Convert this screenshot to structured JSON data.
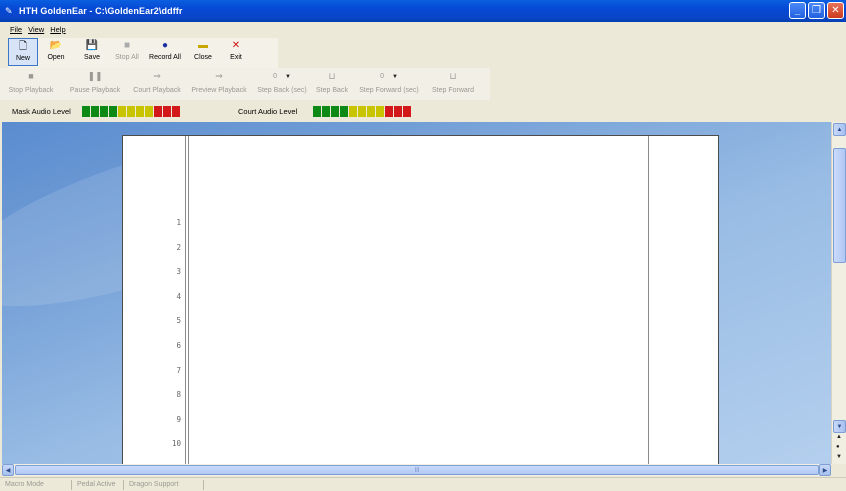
{
  "window": {
    "title": "HTH GoldenEar - C:\\GoldenEar2\\ddffr"
  },
  "menu": {
    "items": [
      "File",
      "View",
      "Help"
    ]
  },
  "toolbar1": {
    "buttons": [
      {
        "label": "New",
        "icon": "new-document-icon"
      },
      {
        "label": "Open",
        "icon": "open-folder-icon"
      },
      {
        "label": "Save",
        "icon": "save-disk-icon"
      },
      {
        "label": "Stop All",
        "icon": "stop-icon"
      },
      {
        "label": "Record All",
        "icon": "record-icon"
      },
      {
        "label": "Close",
        "icon": "close-folder-icon"
      },
      {
        "label": "Exit",
        "icon": "exit-x-icon"
      }
    ]
  },
  "toolbar2": {
    "stop_playback": "Stop Playback",
    "pause_playback": "Pause Playback",
    "court_playback": "Court Playback",
    "preview_playback": "Preview Playback",
    "step_back_sec_value": "0",
    "step_back_sec": "Step Back (sec)",
    "step_back": "Step Back",
    "step_forward_sec_value": "0",
    "step_forward_sec": "Step Forward (sec)",
    "step_forward": "Step Forward"
  },
  "levels": {
    "mask_label": "Mask Audio Level",
    "court_label": "Court Audio Level",
    "segments": [
      "green",
      "green",
      "green",
      "green",
      "yellow",
      "yellow",
      "yellow",
      "yellow",
      "red",
      "red",
      "red"
    ],
    "colors": {
      "green": "#0d8a16",
      "yellow": "#c8c400",
      "red": "#d21818"
    }
  },
  "document": {
    "line_numbers": [
      "1",
      "2",
      "3",
      "4",
      "5",
      "6",
      "7",
      "8",
      "9",
      "10"
    ]
  },
  "statusbar": {
    "panes": [
      "Macro Mode",
      "Pedal Active",
      "Dragon Support"
    ]
  }
}
